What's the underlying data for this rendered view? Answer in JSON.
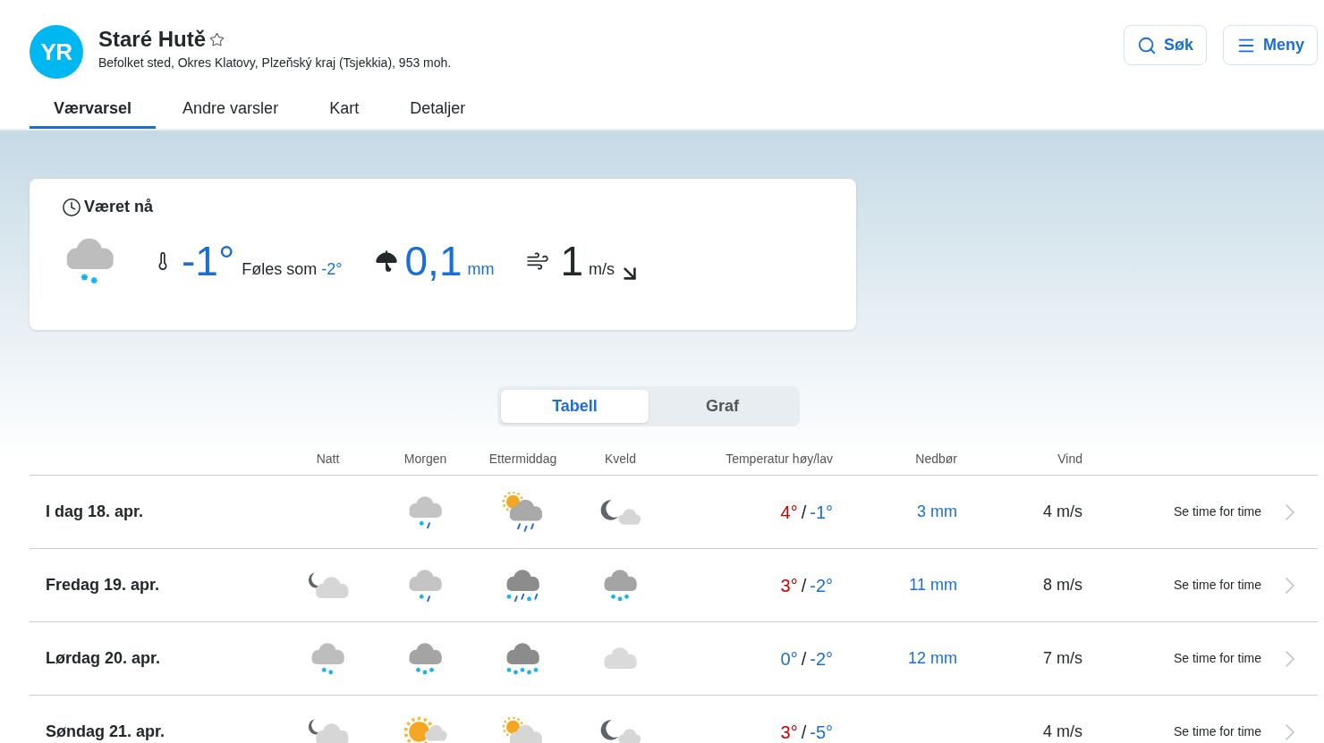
{
  "header": {
    "logo": "YR",
    "title": "Staré Hutě",
    "subtitle": "Befolket sted, Okres Klatovy, Plzeňský kraj (Tsjekkia), 953 moh.",
    "buttons": [
      {
        "kind": "search",
        "label": "Søk"
      },
      {
        "kind": "menu",
        "label": "Meny"
      }
    ]
  },
  "tabs": [
    {
      "label": "Værvarsel",
      "selected": true
    },
    {
      "label": "Andre varsler",
      "selected": false
    },
    {
      "label": "Kart",
      "selected": false
    },
    {
      "label": "Detaljer",
      "selected": false
    }
  ],
  "now": {
    "title": "Været nå",
    "symbol": {
      "kind": "snow-light"
    },
    "temperature": "-1°",
    "feels_label": "Føles som",
    "feels_value": "-2°",
    "precipitation": "0,1",
    "precipitation_unit": "mm",
    "wind": "1",
    "wind_unit": "m/s"
  },
  "view_toggle": [
    {
      "label": "Tabell",
      "selected": true
    },
    {
      "label": "Graf",
      "selected": false
    }
  ],
  "table": {
    "columns": [
      "Natt",
      "Morgen",
      "Ettermiddag",
      "Kveld",
      "Temperatur høy/lav",
      "Nedbør",
      "Vind"
    ],
    "rows": [
      {
        "day": "I dag 18. apr.",
        "morning": {
          "kind": "sleet-light"
        },
        "afternoon": {
          "kind": "partsun-rain"
        },
        "evening": {
          "kind": "moon-cloud"
        },
        "high": {
          "text": "4°",
          "kind": "warm"
        },
        "separator": "/",
        "low": {
          "text": "-1°",
          "kind": "cold"
        },
        "precipitation": "3 mm",
        "wind": "4 m/s",
        "link": "Se time for time"
      },
      {
        "day": "Fredag 19. apr.",
        "night": {
          "kind": "moon-cloud-large"
        },
        "morning": {
          "kind": "sleet-light"
        },
        "afternoon": {
          "kind": "sleet-heavy"
        },
        "evening": {
          "kind": "snow"
        },
        "high": {
          "text": "3°",
          "kind": "warm"
        },
        "separator": "/",
        "low": {
          "text": "-2°",
          "kind": "cold"
        },
        "precipitation": "11 mm",
        "wind": "8 m/s",
        "link": "Se time for time"
      },
      {
        "day": "Lørdag 20. apr.",
        "night": {
          "kind": "snow-light"
        },
        "morning": {
          "kind": "snow"
        },
        "afternoon": {
          "kind": "snow-heavy"
        },
        "evening": {
          "kind": "cloud"
        },
        "high": {
          "text": "0°",
          "kind": "cold"
        },
        "separator": "/",
        "low": {
          "text": "-2°",
          "kind": "cold"
        },
        "precipitation": "12 mm",
        "wind": "7 m/s",
        "link": "Se time for time"
      },
      {
        "day": "Søndag 21. apr.",
        "night": {
          "kind": "moon-cloud-large"
        },
        "morning": {
          "kind": "sun-cloud"
        },
        "afternoon": {
          "kind": "partsun-cloud"
        },
        "evening": {
          "kind": "moon-cloud"
        },
        "high": {
          "text": "3°",
          "kind": "warm"
        },
        "separator": "/",
        "low": {
          "text": "-5°",
          "kind": "cold"
        },
        "wind": "4 m/s",
        "link": "Se time for time"
      }
    ]
  }
}
